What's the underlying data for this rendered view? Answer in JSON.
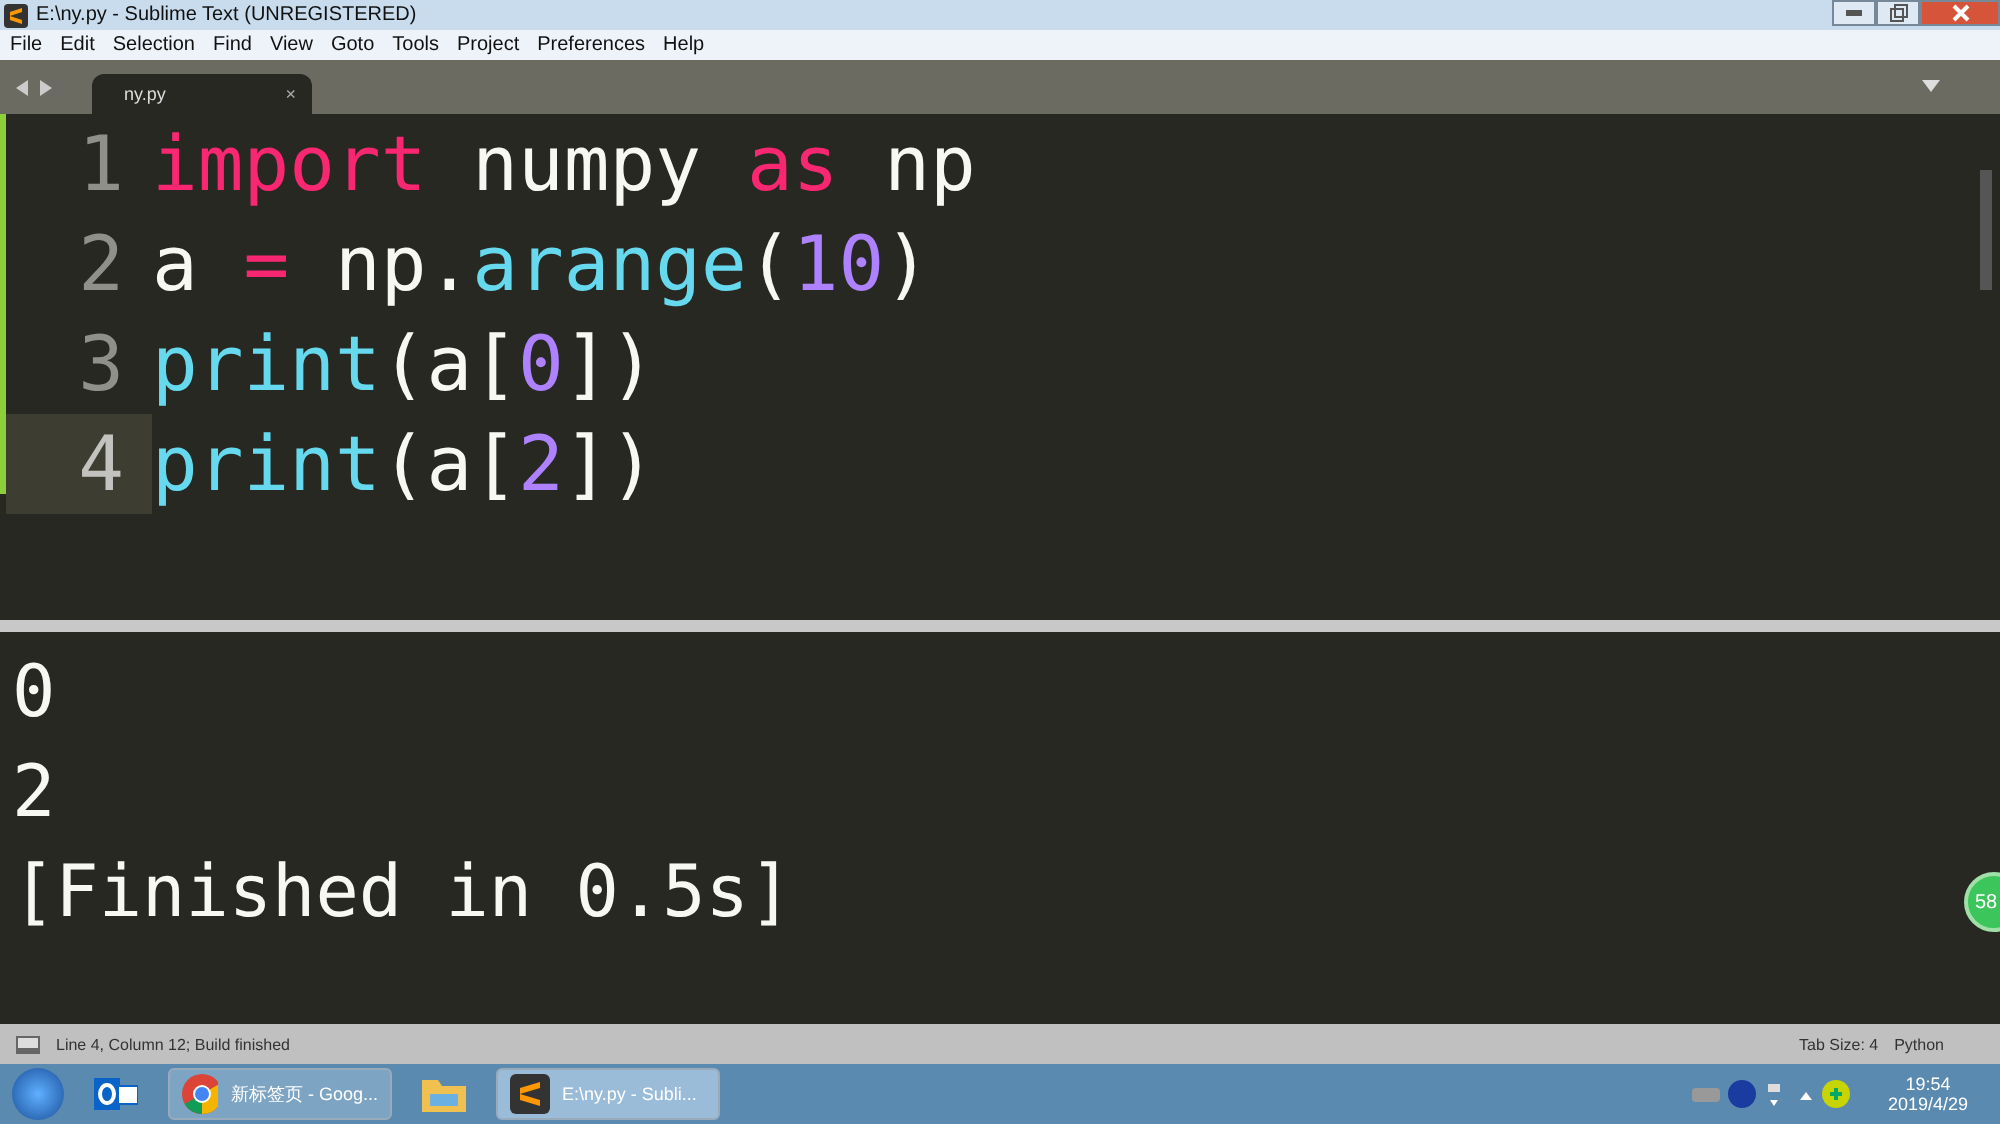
{
  "window": {
    "title": "E:\\ny.py - Sublime Text (UNREGISTERED)"
  },
  "menu": [
    "File",
    "Edit",
    "Selection",
    "Find",
    "View",
    "Goto",
    "Tools",
    "Project",
    "Preferences",
    "Help"
  ],
  "tabs": [
    {
      "label": "ny.py",
      "selected": true,
      "close": "×"
    }
  ],
  "editor": {
    "lines": [
      {
        "number": "1",
        "current": false,
        "tokens": [
          {
            "text": "import",
            "kind": "keyword"
          },
          {
            "text": " numpy ",
            "kind": "plain"
          },
          {
            "text": "as",
            "kind": "keyword"
          },
          {
            "text": " np",
            "kind": "plain"
          }
        ]
      },
      {
        "number": "2",
        "current": false,
        "tokens": [
          {
            "text": "a ",
            "kind": "plain"
          },
          {
            "text": "=",
            "kind": "keyword"
          },
          {
            "text": " np.",
            "kind": "plain"
          },
          {
            "text": "arange",
            "kind": "builtin"
          },
          {
            "text": "(",
            "kind": "plain"
          },
          {
            "text": "10",
            "kind": "number"
          },
          {
            "text": ")",
            "kind": "plain"
          }
        ]
      },
      {
        "number": "3",
        "current": false,
        "tokens": [
          {
            "text": "print",
            "kind": "builtin"
          },
          {
            "text": "(a[",
            "kind": "plain"
          },
          {
            "text": "0",
            "kind": "number"
          },
          {
            "text": "])",
            "kind": "plain"
          }
        ]
      },
      {
        "number": "4",
        "current": true,
        "tokens": [
          {
            "text": "print",
            "kind": "builtin"
          },
          {
            "text": "(a[",
            "kind": "plain"
          },
          {
            "text": "2",
            "kind": "number"
          },
          {
            "text": "])",
            "kind": "plain"
          }
        ]
      }
    ]
  },
  "output": [
    "0",
    "2",
    "[Finished in 0.5s]"
  ],
  "badge": "58",
  "status_bar": {
    "message": "Line 4, Column 12; Build finished",
    "tab_size": "Tab Size: 4",
    "syntax": "Python"
  },
  "taskbar": {
    "apps": [
      {
        "kind": "outlook"
      },
      {
        "kind": "chrome",
        "label": "新标签页 - Goog..."
      },
      {
        "kind": "folder"
      },
      {
        "kind": "sublime",
        "label": "E:\\ny.py - Subli..."
      }
    ],
    "time": "19:54",
    "date": "2019/4/29"
  }
}
